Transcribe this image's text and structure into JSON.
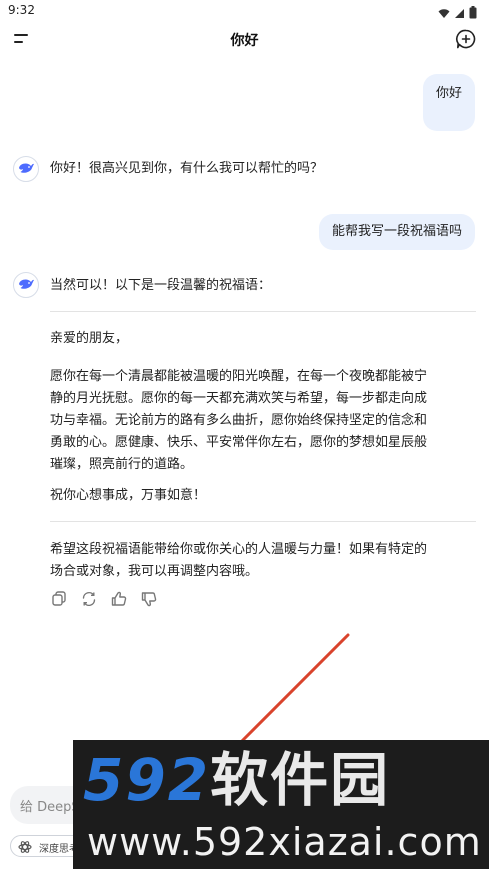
{
  "status_bar": {
    "time": "9:32"
  },
  "header": {
    "title": "你好"
  },
  "messages": {
    "user1": "你好",
    "ai1": "你好！很高兴见到你，有什么我可以帮忙的吗？",
    "user2": "能帮我写一段祝福语吗",
    "ai2_intro": "当然可以！以下是一段温馨的祝福语：",
    "blessing_greeting": "亲爱的朋友，",
    "blessing_body_1": "愿你在每一个清晨都能被温暖的阳光唤醒，在每一个夜晚都能被宁",
    "blessing_body_2": "静的月光抚慰。愿你的每一天都充满欢笑与希望，每一步都走向成",
    "blessing_body_3": "功与幸福。无论前方的路有多么曲折，愿你始终保持坚定的信念和",
    "blessing_body_4": "勇敢的心。愿健康、快乐、平安常伴你左右，愿你的梦想如星辰般",
    "blessing_body_5": "璀璨，照亮前行的道路。",
    "blessing_closing": "祝你心想事成，万事如意！",
    "ai2_outro_1": "希望这段祝福语能带给你或你关心的人温暖与力量！如果有特定的",
    "ai2_outro_2": "场合或对象，我可以再调整内容哦。"
  },
  "input": {
    "placeholder": "给 DeepS"
  },
  "deep_think": {
    "label": "深度思考"
  },
  "watermark": {
    "brand_num": "592",
    "brand_cn": "软件园",
    "url": "www.592xiazai.com"
  },
  "colors": {
    "user_bubble": "#eaf1fd",
    "accent": "#4d6bfe",
    "watermark_blue": "#2a76d8",
    "arrow_red": "#d9432c"
  },
  "icons": [
    "menu-icon",
    "new-chat-icon",
    "wifi-icon",
    "signal-icon",
    "battery-icon",
    "copy-icon",
    "regenerate-icon",
    "thumbs-up-icon",
    "thumbs-down-icon",
    "whale-icon",
    "atom-icon"
  ]
}
